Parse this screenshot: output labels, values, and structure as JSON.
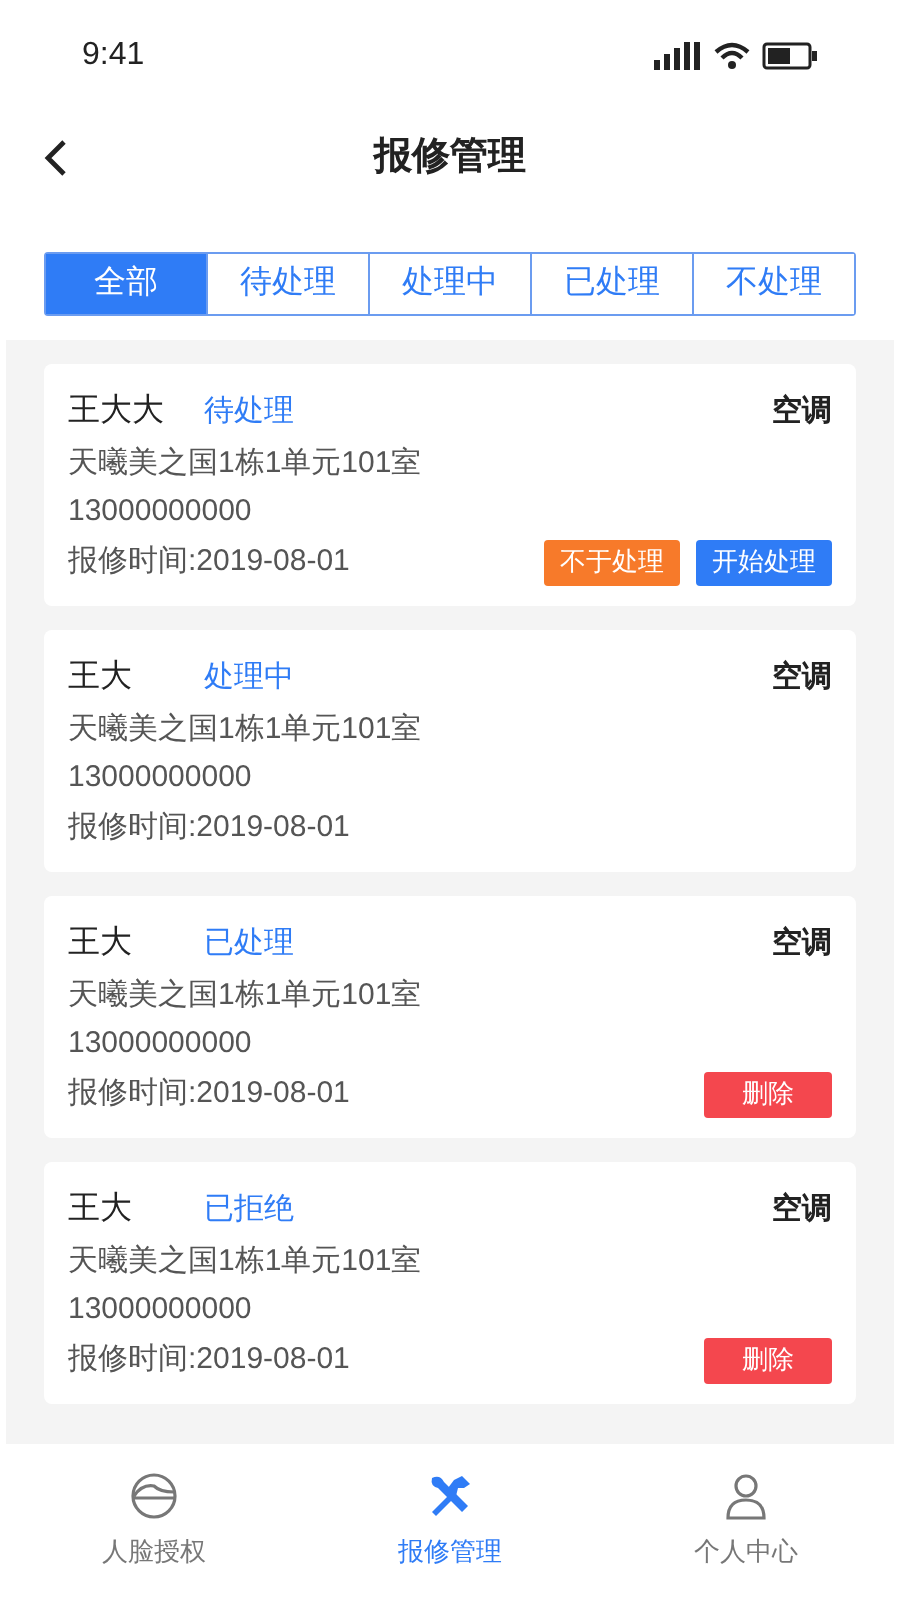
{
  "status_bar": {
    "time": "9:41"
  },
  "header": {
    "title": "报修管理"
  },
  "tabs": [
    {
      "label": "全部",
      "selected": true
    },
    {
      "label": "待处理",
      "selected": false
    },
    {
      "label": "处理中",
      "selected": false
    },
    {
      "label": "已处理",
      "selected": false
    },
    {
      "label": "不处理",
      "selected": false
    }
  ],
  "orders": [
    {
      "name": "王大大",
      "status": "待处理",
      "category": "空调",
      "address": "天曦美之国1栋1单元101室",
      "phone": "13000000000",
      "time": "报修时间:2019-08-01",
      "actions": [
        {
          "label": "不于处理",
          "kind": "reject"
        },
        {
          "label": "开始处理",
          "kind": "start"
        }
      ]
    },
    {
      "name": "王大",
      "status": "处理中",
      "category": "空调",
      "address": "天曦美之国1栋1单元101室",
      "phone": "13000000000",
      "time": "报修时间:2019-08-01"
    },
    {
      "name": "王大",
      "status": "已处理",
      "category": "空调",
      "address": "天曦美之国1栋1单元101室",
      "phone": "13000000000",
      "time": "报修时间:2019-08-01",
      "actions": [
        {
          "label": "删除",
          "kind": "delete"
        }
      ]
    },
    {
      "name": "王大",
      "status": "已拒绝",
      "category": "空调",
      "address": "天曦美之国1栋1单元101室",
      "phone": "13000000000",
      "time": "报修时间:2019-08-01",
      "actions": [
        {
          "label": "删除",
          "kind": "delete"
        }
      ]
    }
  ],
  "bottom_nav": [
    {
      "label": "人脸授权",
      "kind": "face",
      "selected": false
    },
    {
      "label": "报修管理",
      "kind": "tools",
      "selected": true
    },
    {
      "label": "个人中心",
      "kind": "person",
      "selected": false
    }
  ]
}
